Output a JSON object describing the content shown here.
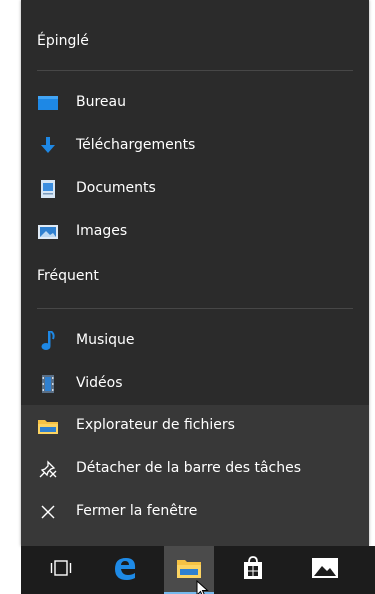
{
  "jumplist": {
    "pinned_header": "Épinglé",
    "frequent_header": "Fréquent",
    "pinned_items": [
      {
        "label": "Bureau",
        "icon": "desktop-folder-icon"
      },
      {
        "label": "Téléchargements",
        "icon": "download-arrow-icon"
      },
      {
        "label": "Documents",
        "icon": "document-icon"
      },
      {
        "label": "Images",
        "icon": "pictures-icon"
      }
    ],
    "frequent_items": [
      {
        "label": "Musique",
        "icon": "music-note-icon"
      },
      {
        "label": "Vidéos",
        "icon": "video-film-icon"
      }
    ],
    "actions": [
      {
        "label": "Explorateur de fichiers",
        "icon": "file-explorer-icon"
      },
      {
        "label": "Détacher de la barre des tâches",
        "icon": "unpin-icon"
      },
      {
        "label": "Fermer la fenêtre",
        "icon": "close-icon"
      }
    ]
  },
  "taskbar": {
    "buttons": [
      {
        "name": "task-view",
        "icon": "task-view-icon"
      },
      {
        "name": "edge",
        "icon": "edge-browser-icon"
      },
      {
        "name": "file-explorer",
        "icon": "file-explorer-icon",
        "active": true
      },
      {
        "name": "store",
        "icon": "store-bag-icon"
      },
      {
        "name": "photos",
        "icon": "photos-icon"
      }
    ]
  },
  "colors": {
    "menu_bg": "#2b2b2b",
    "actions_bg": "#383838",
    "taskbar_bg": "#1c1c1c",
    "accent": "#1e90ff",
    "active_indicator": "#76b9ed"
  }
}
